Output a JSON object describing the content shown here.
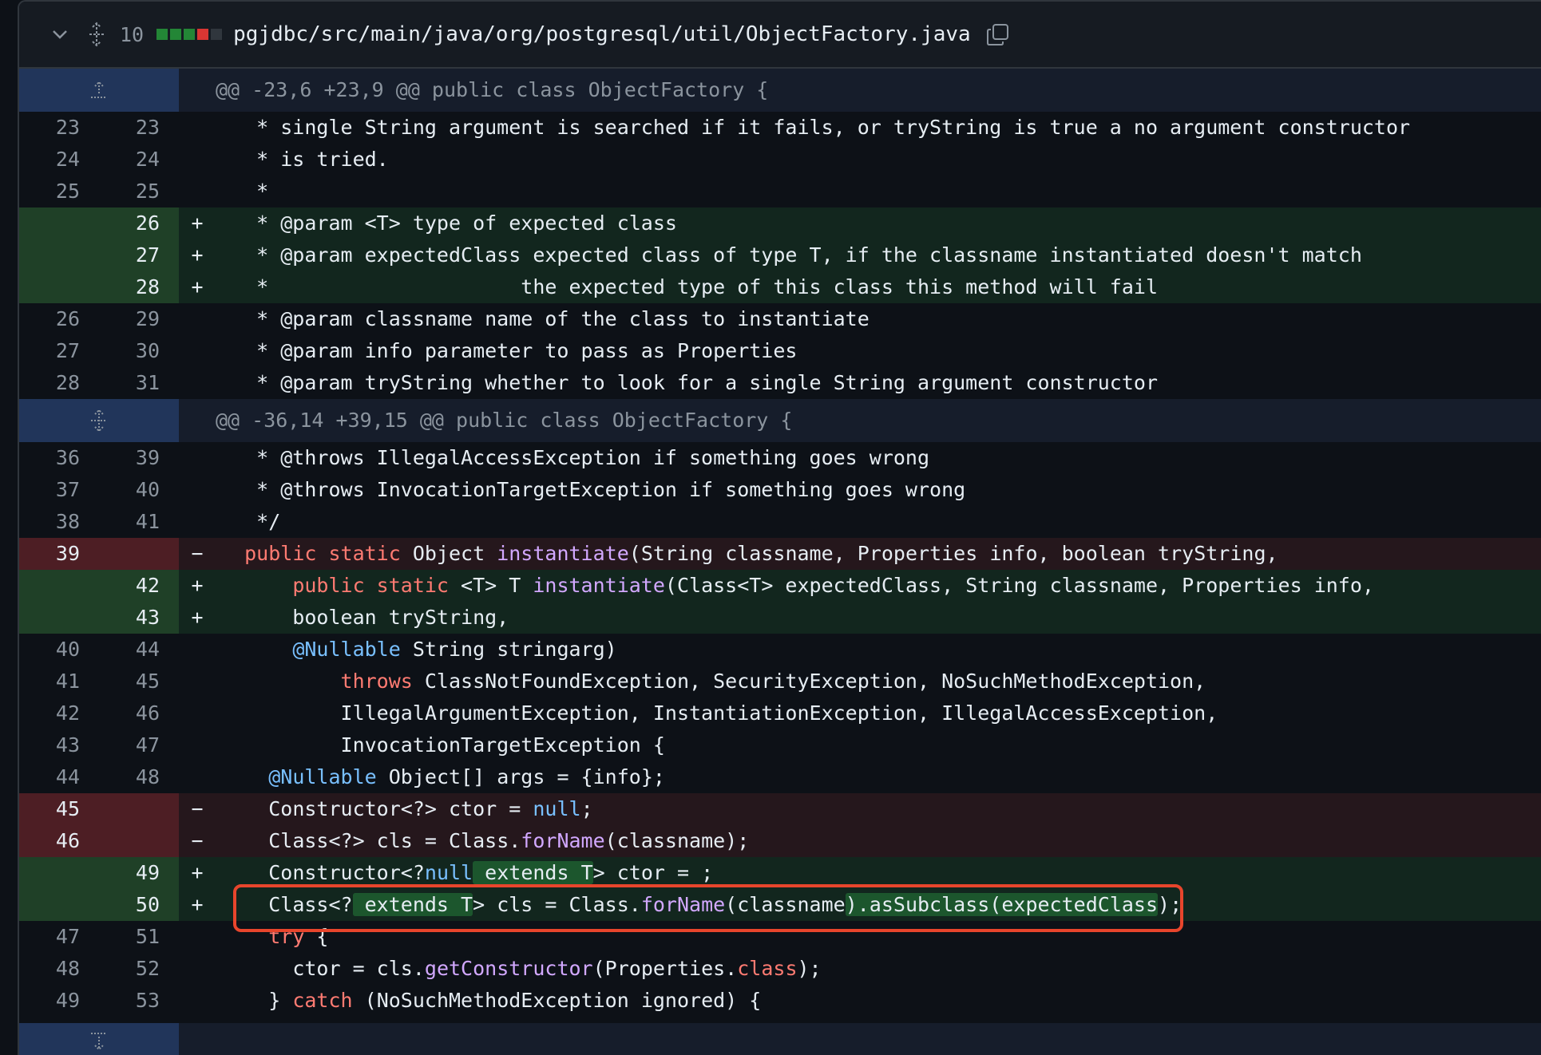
{
  "file": {
    "changes": "10",
    "path": "pgjdbc/src/main/java/org/postgresql/util/ObjectFactory.java",
    "diffstat": [
      "#238636",
      "#238636",
      "#238636",
      "#da3633",
      "#30363d"
    ]
  },
  "hunks": [
    {
      "header": "@@ -23,6 +23,9 @@ public class ObjectFactory {"
    },
    {
      "header": "@@ -36,14 +39,15 @@ public class ObjectFactory {"
    }
  ],
  "lines1": [
    {
      "old": "23",
      "new": "23",
      "m": "",
      "code": "   * single String argument is searched if it fails, or tryString is true a no argument constructor"
    },
    {
      "old": "24",
      "new": "24",
      "m": "",
      "code": "   * is tried."
    },
    {
      "old": "25",
      "new": "25",
      "m": "",
      "code": "   *"
    },
    {
      "old": "",
      "new": "26",
      "m": "+",
      "code": "   * @param <T> type of expected class"
    },
    {
      "old": "",
      "new": "27",
      "m": "+",
      "code": "   * @param expectedClass expected class of type T, if the classname instantiated doesn't match"
    },
    {
      "old": "",
      "new": "28",
      "m": "+",
      "code": "   *                     the expected type of this class this method will fail"
    },
    {
      "old": "26",
      "new": "29",
      "m": "",
      "code": "   * @param classname name of the class to instantiate"
    },
    {
      "old": "27",
      "new": "30",
      "m": "",
      "code": "   * @param info parameter to pass as Properties"
    },
    {
      "old": "28",
      "new": "31",
      "m": "",
      "code": "   * @param tryString whether to look for a single String argument constructor"
    }
  ],
  "lines2": [
    {
      "old": "36",
      "new": "39",
      "m": "",
      "code": "   * @throws IllegalAccessException if something goes wrong"
    },
    {
      "old": "37",
      "new": "40",
      "m": "",
      "code": "   * @throws InvocationTargetException if something goes wrong"
    },
    {
      "old": "38",
      "new": "41",
      "m": "",
      "code": "   */"
    },
    {
      "old": "39",
      "new": "",
      "m": "−",
      "k1": "public static",
      "t1": " Object ",
      "f1": "instantiate",
      "r1": "(String classname, Properties info, boolean tryString,"
    },
    {
      "old": "",
      "new": "42",
      "m": "+",
      "k1": "public static",
      "t1": " <T> T ",
      "f1": "instantiate",
      "r1": "(Class<T> expectedClass, String classname, Properties info,"
    },
    {
      "old": "",
      "new": "43",
      "m": "+",
      "code": "      boolean tryString,"
    },
    {
      "old": "40",
      "new": "44",
      "m": "",
      "a1": "@Nullable",
      "r1": " String stringarg)"
    },
    {
      "old": "41",
      "new": "45",
      "m": "",
      "k1": "throws",
      "r1": " ClassNotFoundException, SecurityException, NoSuchMethodException,"
    },
    {
      "old": "42",
      "new": "46",
      "m": "",
      "code": "          IllegalArgumentException, InstantiationException, IllegalAccessException,"
    },
    {
      "old": "43",
      "new": "47",
      "m": "",
      "code": "          InvocationTargetException {"
    },
    {
      "old": "44",
      "new": "48",
      "m": "",
      "a1": "@Nullable",
      "r1": " Object[] args = {info};"
    },
    {
      "old": "45",
      "new": "",
      "m": "−",
      "p1": "Constructor<?> ctor = ",
      "a1": "null",
      "r1": ";"
    },
    {
      "old": "46",
      "new": "",
      "m": "−",
      "p1": "Class<?> cls = Class.",
      "f1": "forName",
      "r1": "(classname);"
    },
    {
      "old": "",
      "new": "49",
      "m": "+",
      "p1": "Constructor<?",
      "h1": " extends T",
      "p2": "> ctor = ",
      "a1": "null",
      "r1": ";"
    },
    {
      "old": "",
      "new": "50",
      "m": "+",
      "p1": "Class<?",
      "h1": " extends T",
      "p2": "> cls = Class.",
      "f1": "forName",
      "q1": "(classname",
      "h2": ").asSubclass(expectedClass",
      "r1": ");"
    },
    {
      "old": "47",
      "new": "51",
      "m": "",
      "k1": "try",
      "r1": " {"
    },
    {
      "old": "48",
      "new": "52",
      "m": "",
      "p1": "ctor = cls.",
      "f1": "getConstructor",
      "q1": "(Properties.",
      "k2": "class",
      "r1": ");"
    },
    {
      "old": "49",
      "new": "53",
      "m": "",
      "p1": "} ",
      "k1": "catch",
      "r1": " (NoSuchMethodException ignored) {"
    }
  ]
}
